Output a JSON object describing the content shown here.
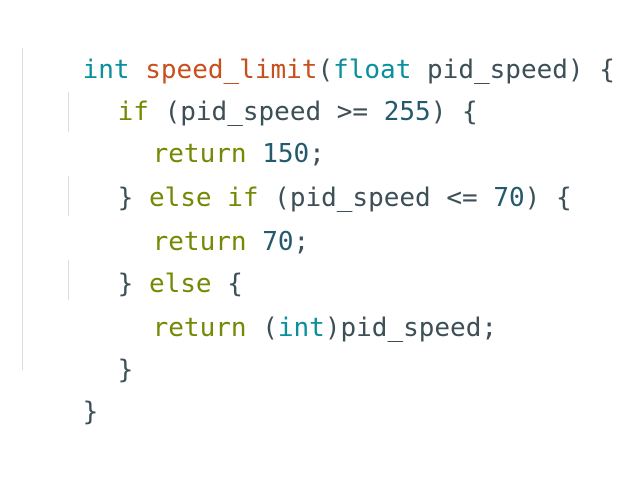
{
  "theme": {
    "keyword_color": "#0a8f9e",
    "control_color": "#738a05",
    "function_color": "#c8501e",
    "number_color": "#235a6d",
    "text_color": "#3d4f57",
    "guide_color": "#dcdcdc",
    "background": "#ffffff"
  },
  "code": {
    "line1": {
      "type": "int",
      "name": "speed_limit",
      "open_paren": "(",
      "param_type": "float",
      "param_rest": " pid_speed) {"
    },
    "line2": {
      "kw": "if",
      "cond": " (pid_speed >= ",
      "num": "255",
      "tail": ") {"
    },
    "line3": {
      "kw": "return",
      "num": "150",
      "tail": ";"
    },
    "line4": {
      "brace": "} ",
      "kw": "else if",
      "cond": " (pid_speed <= ",
      "num": "70",
      "tail": ") {"
    },
    "line5": {
      "kw": "return",
      "num": "70",
      "tail": ";"
    },
    "line6": {
      "brace": "} ",
      "kw": "else",
      "tail": " {"
    },
    "line7": {
      "kw": "return",
      "cast_open": " (",
      "cast_type": "int",
      "cast_rest": ")pid_speed;"
    },
    "line8": {
      "brace": "}"
    },
    "line9": {
      "brace": "}"
    }
  }
}
